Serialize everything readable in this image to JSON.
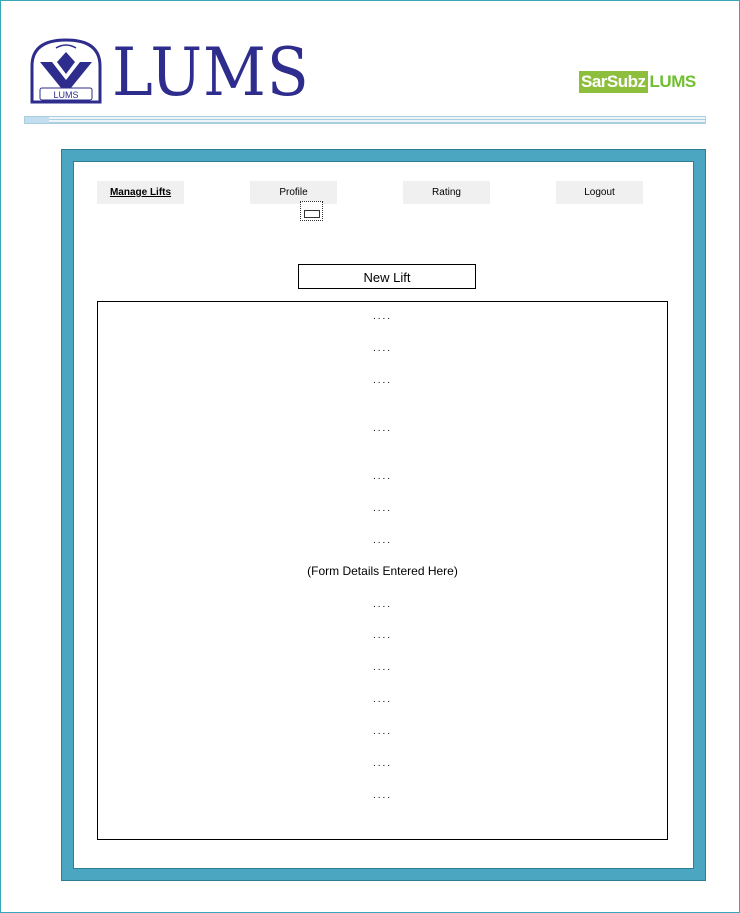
{
  "header": {
    "logo_text": "LUMS",
    "emblem_text": "LUMS",
    "brand": {
      "box_text": "SarSubz",
      "suffix_text": "LUMS"
    }
  },
  "nav": {
    "items": [
      {
        "label": "Manage Lifts",
        "active": true
      },
      {
        "label": "Profile",
        "active": false
      },
      {
        "label": "Rating",
        "active": false
      },
      {
        "label": "Logout",
        "active": false
      }
    ]
  },
  "main": {
    "new_lift_label": "New Lift",
    "form": {
      "placeholder": "....",
      "caption": "(Form Details Entered Here)"
    }
  },
  "colors": {
    "panel": "#4ba7c1",
    "logo_blue": "#2e2c8c",
    "brand_green": "#8dbf3c"
  }
}
